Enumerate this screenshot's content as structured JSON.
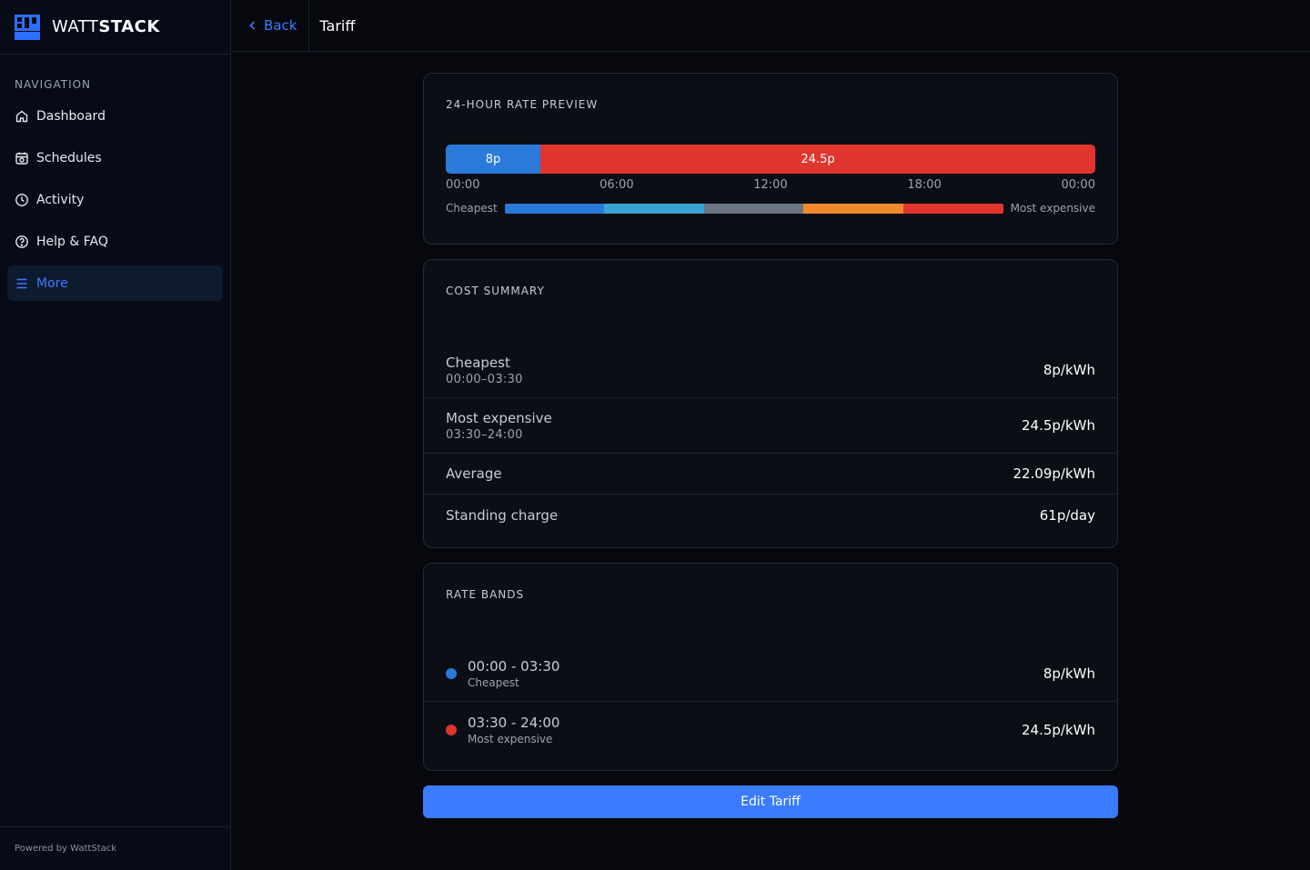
{
  "brand": {
    "name_light": "WATT",
    "name_bold": "STACK"
  },
  "sidebar": {
    "heading": "NAVIGATION",
    "items": [
      {
        "label": "Dashboard",
        "icon": "home-icon"
      },
      {
        "label": "Schedules",
        "icon": "calendar-icon"
      },
      {
        "label": "Activity",
        "icon": "clock-icon"
      },
      {
        "label": "Help & FAQ",
        "icon": "help-circle-icon"
      },
      {
        "label": "More",
        "icon": "menu-icon",
        "active": true
      }
    ],
    "footer": "Powered by WattStack"
  },
  "topbar": {
    "back_label": "Back",
    "title": "Tariff"
  },
  "preview": {
    "title": "24-HOUR RATE PREVIEW",
    "segments": [
      {
        "label": "8p",
        "fraction": 0.1458,
        "color": "#2a7ad9"
      },
      {
        "label": "24.5p",
        "fraction": 0.8542,
        "color": "#e0352f"
      }
    ],
    "time_labels": [
      "00:00",
      "06:00",
      "12:00",
      "18:00",
      "00:00"
    ],
    "legend": {
      "low": "Cheapest",
      "high": "Most expensive",
      "colors": [
        "#2a7ad9",
        "#3aa4d4",
        "#6b7480",
        "#f08a2c",
        "#e0352f"
      ]
    }
  },
  "summary": {
    "title": "COST SUMMARY",
    "rows": [
      {
        "label": "Cheapest",
        "sub": "00:00–03:30",
        "value": "8p/kWh"
      },
      {
        "label": "Most expensive",
        "sub": "03:30–24:00",
        "value": "24.5p/kWh"
      },
      {
        "label": "Average",
        "value": "22.09p/kWh"
      },
      {
        "label": "Standing charge",
        "value": "61p/day"
      }
    ]
  },
  "bands": {
    "title": "RATE BANDS",
    "rows": [
      {
        "time": "00:00 - 03:30",
        "sub": "Cheapest",
        "value": "8p/kWh",
        "color": "#2a7ad9"
      },
      {
        "time": "03:30 - 24:00",
        "sub": "Most expensive",
        "value": "24.5p/kWh",
        "color": "#e0352f"
      }
    ]
  },
  "edit_button": "Edit Tariff"
}
